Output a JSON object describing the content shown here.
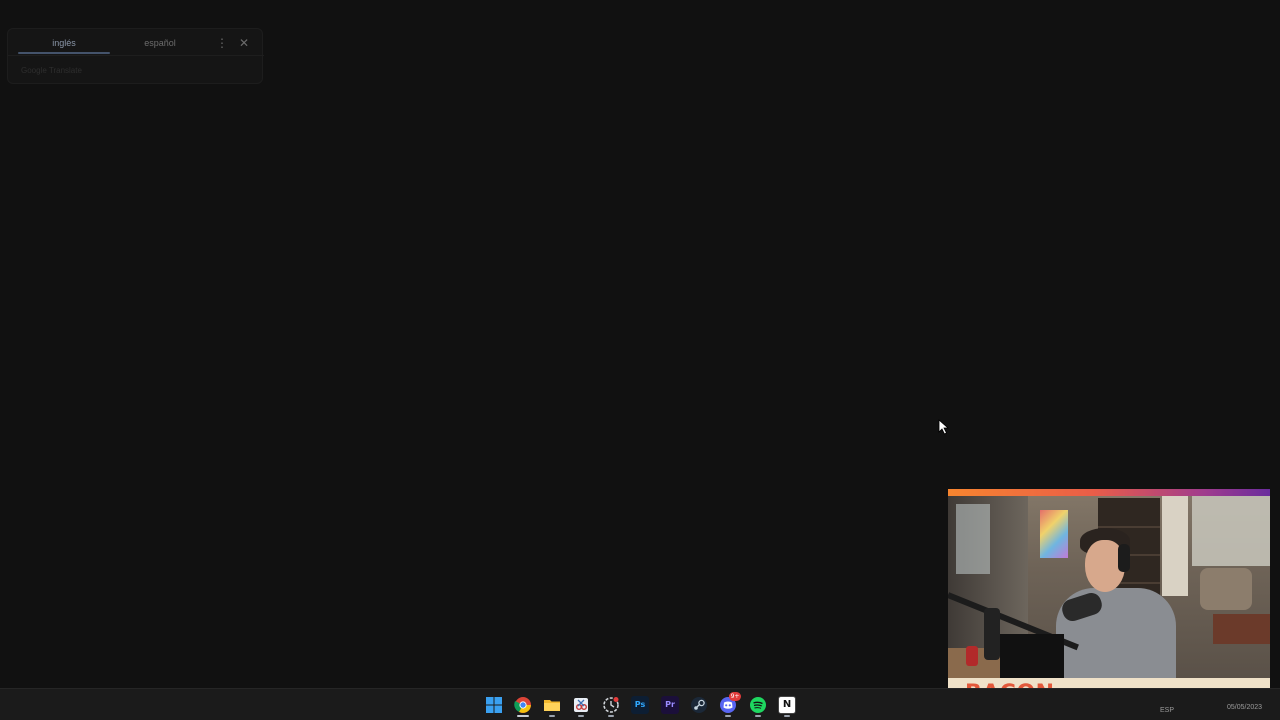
{
  "translate_popup": {
    "source_language": "inglés",
    "target_language": "español",
    "brand": "Google Translate"
  },
  "webcam": {
    "name_label": "BACON"
  },
  "taskbar": {
    "apps": [
      {
        "id": "start",
        "name": "start-menu-icon"
      },
      {
        "id": "chrome",
        "name": "chrome-icon",
        "active": true
      },
      {
        "id": "explorer",
        "name": "file-explorer-icon"
      },
      {
        "id": "snipping",
        "name": "snipping-tool-icon"
      },
      {
        "id": "clock",
        "name": "clock-app-icon"
      },
      {
        "id": "photoshop",
        "name": "photoshop-icon",
        "glyph": "Ps"
      },
      {
        "id": "premiere",
        "name": "premiere-icon",
        "glyph": "Pr"
      },
      {
        "id": "steam",
        "name": "steam-icon"
      },
      {
        "id": "discord",
        "name": "discord-icon",
        "badge": "9+"
      },
      {
        "id": "spotify",
        "name": "spotify-icon"
      },
      {
        "id": "notion",
        "name": "notion-icon",
        "glyph": "N"
      }
    ],
    "tray_language": "ESP",
    "tray_date": "05/05/2023"
  },
  "colors": {
    "desktop_bg": "#111111",
    "taskbar_bg": "#1b1b1b",
    "webcam_accent_start": "#f7852f",
    "webcam_accent_end": "#6a2c9d",
    "webcam_label_bg": "#efe1c8",
    "webcam_name": "#e2583a"
  }
}
